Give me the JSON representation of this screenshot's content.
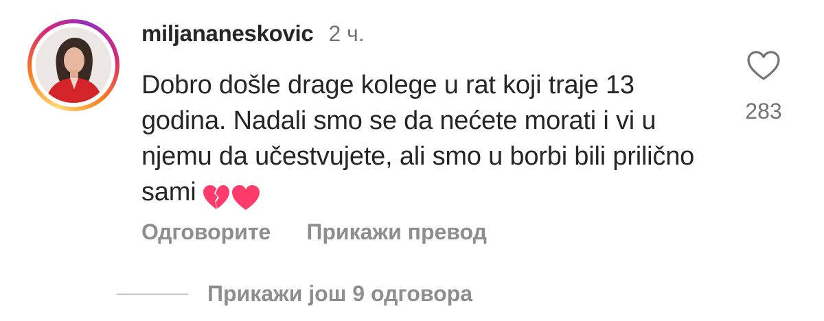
{
  "comment": {
    "username": "miljananeskovic",
    "time": "2 ч.",
    "text": "Dobro došle drage kolege u rat koji traje 13 godina. Nadali smo se da nećete morati i vi u njemu da učestvujete, ali smo u borbi bili prilično sami",
    "emojis": [
      "broken-heart",
      "heart"
    ],
    "likes": "283"
  },
  "actions": {
    "reply_label": "Одговорите",
    "translate_label": "Прикажи превод"
  },
  "replies": {
    "label": "Прикажи још 9 одговора"
  },
  "colors": {
    "text": "#262626",
    "muted": "#8e8e8e",
    "story_ring": [
      "#feda75",
      "#fa7e1e",
      "#d62976",
      "#962fbf"
    ],
    "heart_emoji": "#ff3b6b"
  },
  "icons": {
    "like": "heart-outline-icon",
    "emoji_1": "broken-heart-emoji",
    "emoji_2": "pink-heart-emoji"
  }
}
